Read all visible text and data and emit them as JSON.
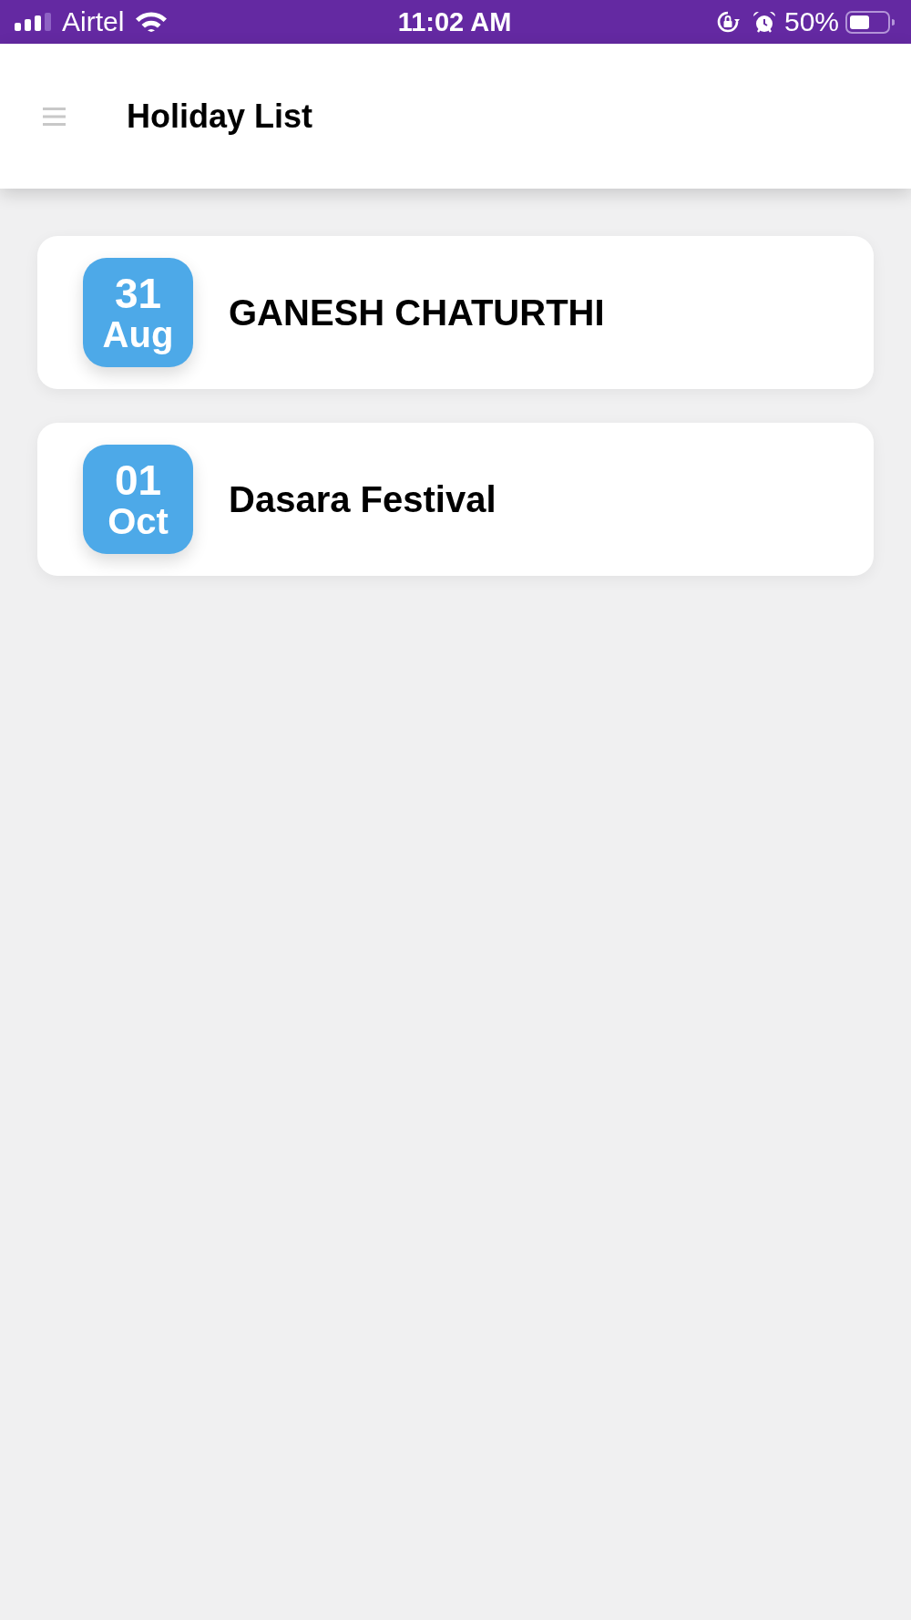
{
  "status_bar": {
    "carrier": "Airtel",
    "time": "11:02 AM",
    "battery_percent": "50%"
  },
  "header": {
    "title": "Holiday List"
  },
  "holidays": [
    {
      "day": "31",
      "month": "Aug",
      "name": "GANESH CHATURTHI"
    },
    {
      "day": "01",
      "month": "Oct",
      "name": "Dasara Festival"
    }
  ]
}
